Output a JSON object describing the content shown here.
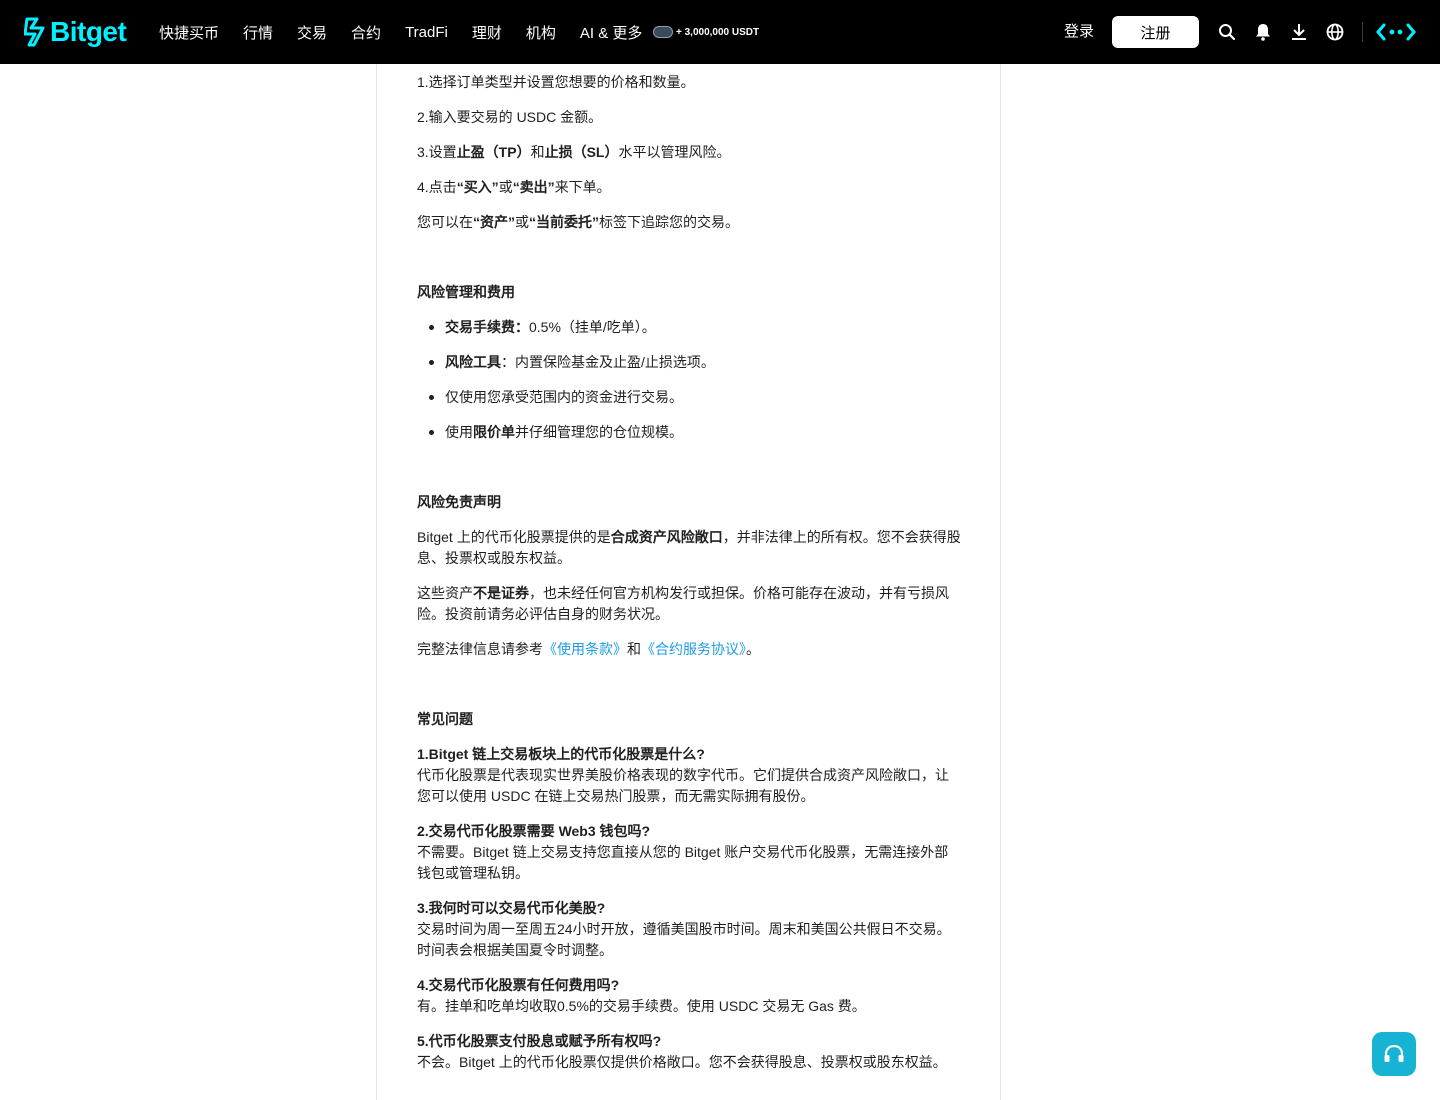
{
  "header": {
    "brand": "Bitget",
    "nav": [
      "快捷买币",
      "行情",
      "交易",
      "合约",
      "TradFi",
      "理财",
      "机构",
      "AI & 更多"
    ],
    "promo": "+ 3,000,000 USDT",
    "login": "登录",
    "register": "注册",
    "icons": [
      "search-icon",
      "bell-icon",
      "download-icon",
      "globe-icon",
      "bitget-ai-icon"
    ]
  },
  "colors": {
    "brand": "#00f0ff",
    "link": "#1e9ce0",
    "support": "#16b3d4"
  },
  "steps": {
    "s1": "1.选择订单类型并设置您想要的价格和数量。",
    "s2": "2.输入要交易的 USDC 金额。",
    "s3_a": "3.设置",
    "s3_tp": "止盈（TP）",
    "s3_and": "和",
    "s3_sl": "止损（SL）",
    "s3_b": "水平以管理风险。",
    "s4_a": "4.点击",
    "s4_buy": "“买入”",
    "s4_or": "或",
    "s4_sell": "“卖出”",
    "s4_b": "来下单。",
    "track_a": "您可以在",
    "track_assets": "“资产”",
    "track_or": "或",
    "track_orders": "“当前委托”",
    "track_b": "标签下追踪您的交易。"
  },
  "risk": {
    "heading": "风险管理和费用",
    "fee_label": "交易手续费：",
    "fee_text": "0.5%（挂单/吃单）。",
    "tool_label": "风险工具",
    "tool_text": "：内置保险基金及止盈/止损选项。",
    "capital": "仅使用您承受范围内的资金进行交易。",
    "limit_a": "使用",
    "limit_b": "限价单",
    "limit_c": "并仔细管理您的仓位规模。"
  },
  "disclaimer": {
    "heading": "风险免责声明",
    "p1_a": "Bitget 上的代币化股票提供的是",
    "p1_b": "合成资产风险敞口",
    "p1_c": "，并非法律上的所有权。您不会获得股息、投票权或股东权益。",
    "p2_a": "这些资产",
    "p2_b": "不是证券",
    "p2_c": "，也未经任何官方机构发行或担保。价格可能存在波动，并有亏损风险。投资前请务必评估自身的财务状况。",
    "p3_a": "完整法律信息请参考",
    "p3_link1": "《使用条款》",
    "p3_and": "和",
    "p3_link2": "《合约服务协议》",
    "p3_end": "。"
  },
  "faq": {
    "heading": "常见问题",
    "items": [
      {
        "q": "1.Bitget 链上交易板块上的代币化股票是什么?",
        "a": "代币化股票是代表现实世界美股价格表现的数字代币。它们提供合成资产风险敞口，让您可以使用 USDC 在链上交易热门股票，而无需实际拥有股份。"
      },
      {
        "q": "2.交易代币化股票需要 Web3 钱包吗?",
        "a": "不需要。Bitget 链上交易支持您直接从您的 Bitget 账户交易代币化股票，无需连接外部钱包或管理私钥。"
      },
      {
        "q": "3.我何时可以交易代币化美股?",
        "a": "交易时间为周一至周五24小时开放，遵循美国股市时间。周末和美国公共假日不交易。时间表会根据美国夏令时调整。"
      },
      {
        "q": "4.交易代币化股票有任何费用吗?",
        "a": "有。挂单和吃单均收取0.5%的交易手续费。使用 USDC 交易无 Gas 费。"
      },
      {
        "q": "5.代币化股票支付股息或赋予所有权吗?",
        "a": "不会。Bitget 上的代币化股票仅提供价格敞口。您不会获得股息、投票权或股东权益。"
      }
    ]
  }
}
